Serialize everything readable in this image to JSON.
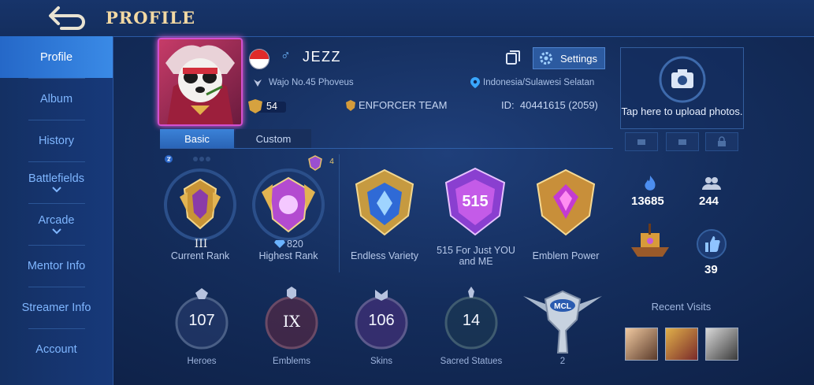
{
  "header": {
    "title": "PROFILE",
    "back_icon": "back-arrow-icon"
  },
  "sidebar": {
    "items": [
      {
        "label": "Profile",
        "active": true
      },
      {
        "label": "Album"
      },
      {
        "label": "History"
      },
      {
        "label": "Battlefields",
        "expandable": true
      },
      {
        "label": "Arcade",
        "expandable": true
      },
      {
        "label": "Mentor Info"
      },
      {
        "label": "Streamer Info"
      },
      {
        "label": "Account"
      }
    ]
  },
  "player": {
    "name": "JEZZ",
    "gender_symbol": "♂",
    "flag_icon": "indonesia-flag-icon",
    "title_line": "Wajo No.45 Phoveus",
    "location": "Indonesia/Sulawesi Selatan",
    "level": "54",
    "team": "ENFORCER TEAM",
    "id_label": "ID:",
    "id_value": "40441615 (2059)"
  },
  "actions": {
    "settings_label": "Settings"
  },
  "tabs": [
    {
      "label": "Basic",
      "active": true
    },
    {
      "label": "Custom"
    }
  ],
  "medals": {
    "current_rank": {
      "tier": "III",
      "label": "Current Rank"
    },
    "highest_rank": {
      "points": "820",
      "label": "Highest Rank",
      "badge_count": "4"
    },
    "achievements": [
      {
        "label": "Endless Variety"
      },
      {
        "label": "515 For Just YOU and ME",
        "emblem_text": "515"
      },
      {
        "label": "Emblem Power"
      }
    ]
  },
  "stats": [
    {
      "value": "107",
      "label": "Heroes"
    },
    {
      "value": "IX",
      "label": "Emblems"
    },
    {
      "value": "106",
      "label": "Skins"
    },
    {
      "value": "14",
      "label": "Sacred Statues"
    }
  ],
  "mcl": {
    "text": "MCL",
    "count": "2"
  },
  "right_panel": {
    "upload_text": "Tap here to upload photos.",
    "popularity": "13685",
    "friends": "244",
    "likes": "39",
    "recent_visits_label": "Recent Visits"
  },
  "colors": {
    "accent": "#3a8ae6",
    "title_gold": "#f3d9a3",
    "sidebar_text": "#7fb6ff"
  }
}
